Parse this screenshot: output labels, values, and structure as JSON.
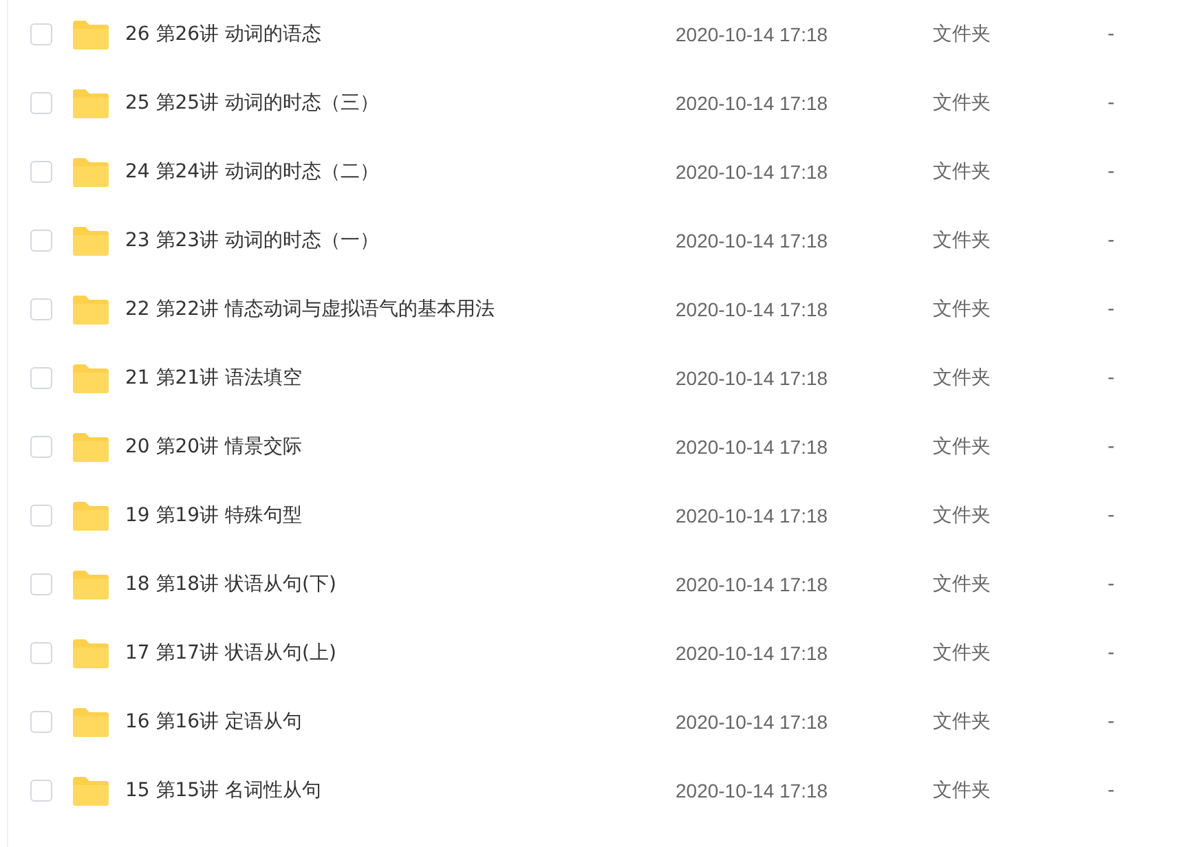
{
  "files": [
    {
      "name": "26 第26讲 动词的语态",
      "modified": "2020-10-14 17:18",
      "type": "文件夹",
      "size": "-",
      "checked": false
    },
    {
      "name": "25 第25讲 动词的时态（三）",
      "modified": "2020-10-14 17:18",
      "type": "文件夹",
      "size": "-",
      "checked": false
    },
    {
      "name": "24 第24讲 动词的时态（二）",
      "modified": "2020-10-14 17:18",
      "type": "文件夹",
      "size": "-",
      "checked": false
    },
    {
      "name": "23 第23讲 动词的时态（一）",
      "modified": "2020-10-14 17:18",
      "type": "文件夹",
      "size": "-",
      "checked": false
    },
    {
      "name": "22 第22讲 情态动词与虚拟语气的基本用法",
      "modified": "2020-10-14 17:18",
      "type": "文件夹",
      "size": "-",
      "checked": false
    },
    {
      "name": "21 第21讲 语法填空",
      "modified": "2020-10-14 17:18",
      "type": "文件夹",
      "size": "-",
      "checked": false
    },
    {
      "name": "20 第20讲 情景交际",
      "modified": "2020-10-14 17:18",
      "type": "文件夹",
      "size": "-",
      "checked": false
    },
    {
      "name": "19 第19讲 特殊句型",
      "modified": "2020-10-14 17:18",
      "type": "文件夹",
      "size": "-",
      "checked": false
    },
    {
      "name": "18 第18讲 状语从句(下)",
      "modified": "2020-10-14 17:18",
      "type": "文件夹",
      "size": "-",
      "checked": false
    },
    {
      "name": "17 第17讲 状语从句(上)",
      "modified": "2020-10-14 17:18",
      "type": "文件夹",
      "size": "-",
      "checked": false
    },
    {
      "name": "16 第16讲 定语从句",
      "modified": "2020-10-14 17:18",
      "type": "文件夹",
      "size": "-",
      "checked": false
    },
    {
      "name": "15 第15讲 名词性从句",
      "modified": "2020-10-14 17:18",
      "type": "文件夹",
      "size": "-",
      "checked": false
    }
  ]
}
